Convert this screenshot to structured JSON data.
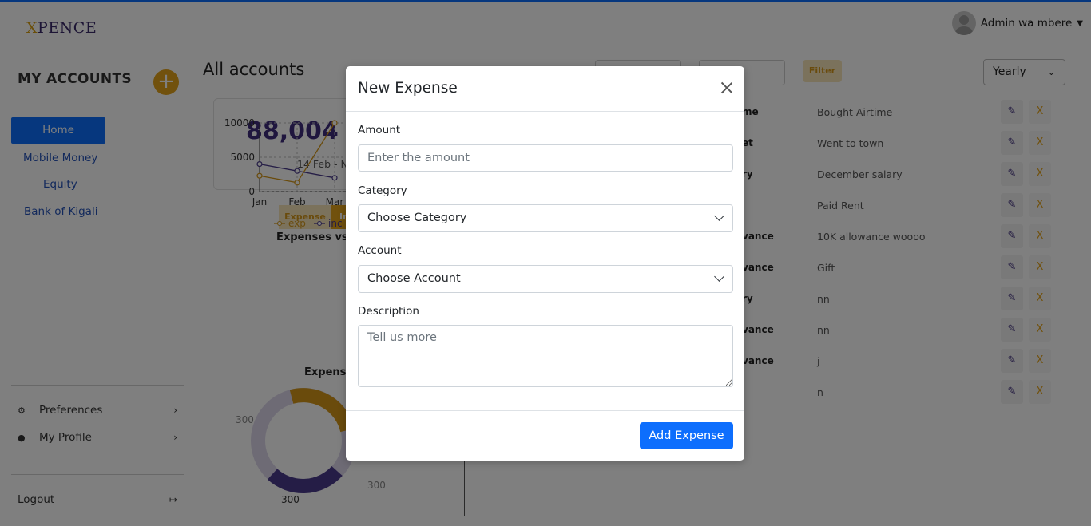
{
  "header": {
    "logo_x": "X",
    "logo_rest": "PENCE",
    "user_name": "Admin wa mbere"
  },
  "sidebar": {
    "title": "MY ACCOUNTS",
    "add_symbol": "+",
    "home": "Home",
    "accounts": [
      "Mobile Money",
      "Equity",
      "Bank of Kigali"
    ],
    "preferences": "Preferences",
    "profile": "My Profile",
    "logout": "Logout"
  },
  "main": {
    "title": "All accounts",
    "filter_label": "Filter",
    "period": "Yearly",
    "stat_value": "88,004",
    "stat_date": "14 Feb - N",
    "tab_expense": "Expense",
    "tab_income": "In",
    "chart_title": "Expenses vs I",
    "chart2_title": "Expense",
    "rows": [
      {
        "label": "me",
        "desc": "Bought Airtime"
      },
      {
        "label": "et",
        "desc": "Went to town"
      },
      {
        "label": "ry",
        "desc": "December salary"
      },
      {
        "label": "",
        "desc": "Paid Rent"
      },
      {
        "label": "vance",
        "desc": "10K allowance woooo"
      },
      {
        "label": "vance",
        "desc": "Gift"
      },
      {
        "label": "ry",
        "desc": "nn"
      },
      {
        "label": "vance",
        "desc": "nn"
      },
      {
        "label": "vance",
        "desc": "j"
      },
      {
        "label": "",
        "desc": "n"
      }
    ],
    "delete_symbol": "X"
  },
  "chart_data": {
    "type": "line",
    "title": "Expenses vs I",
    "categories": [
      "Jan",
      "Feb",
      "Mar"
    ],
    "y_ticks": [
      "10000",
      "5000",
      "0"
    ],
    "ylim": [
      0,
      10000
    ],
    "series": [
      {
        "name": "exp",
        "color": "#d49718",
        "values": [
          2300,
          1300,
          10000
        ]
      },
      {
        "name": "inc",
        "color": "#4a3a8c",
        "values": [
          4000,
          3000,
          2000
        ]
      }
    ],
    "donut_labels": [
      "300",
      "300",
      "300"
    ]
  },
  "modal": {
    "title": "New Expense",
    "amount_label": "Amount",
    "amount_placeholder": "Enter the amount",
    "category_label": "Category",
    "category_value": "Choose Category",
    "account_label": "Account",
    "account_value": "Choose Account",
    "description_label": "Description",
    "description_placeholder": "Tell us more",
    "submit_label": "Add Expense"
  }
}
